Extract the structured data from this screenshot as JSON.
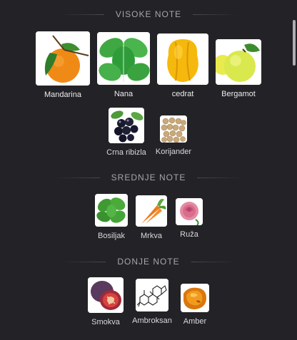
{
  "sections": {
    "top": {
      "title": "VISOKE NOTE",
      "notes": [
        {
          "label": "Mandarina",
          "icon": "mandarin-icon"
        },
        {
          "label": "Nana",
          "icon": "mint-icon"
        },
        {
          "label": "cedrat",
          "icon": "citron-icon"
        },
        {
          "label": "Bergamot",
          "icon": "bergamot-icon"
        },
        {
          "label": "Crna ribizla",
          "icon": "blackcurrant-icon"
        },
        {
          "label": "Korijander",
          "icon": "coriander-icon"
        }
      ]
    },
    "middle": {
      "title": "SREDNJE NOTE",
      "notes": [
        {
          "label": "Bosiljak",
          "icon": "basil-icon"
        },
        {
          "label": "Mrkva",
          "icon": "carrot-icon"
        },
        {
          "label": "Ruža",
          "icon": "rose-icon"
        }
      ]
    },
    "base": {
      "title": "DONJE NOTE",
      "notes": [
        {
          "label": "Smokva",
          "icon": "fig-icon"
        },
        {
          "label": "Ambroksan",
          "icon": "ambroxan-icon"
        },
        {
          "label": "Amber",
          "icon": "amber-icon"
        }
      ]
    }
  }
}
